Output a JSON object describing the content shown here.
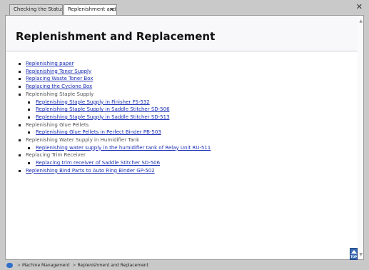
{
  "tabs": [
    {
      "label": "Checking the Status I..."
    },
    {
      "label": "Replenishment and...",
      "close": "✕"
    }
  ],
  "window": {
    "close": "✕"
  },
  "page": {
    "title": "Replenishment and Replacement"
  },
  "toc": {
    "replenishing_paper": "Replenishing paper",
    "replenishing_toner": "Replenishing Toner Supply",
    "replacing_waste_toner": "Replacing Waste Toner Box",
    "replacing_cyclone": "Replacing the Cyclone Box",
    "staple_group": "Replenishing Staple Supply",
    "staple_fs532": "Replenishing Staple Supply in Finisher FS-532",
    "staple_sd506": "Replenishing Staple Supply in Saddle Stitcher SD-506",
    "staple_sd513": "Replenishing Staple Supply in Saddle Stitcher SD-513",
    "glue_group": "Replenishing Glue Pellets",
    "glue_pb503": "Replenishing Glue Pellets in Perfect Binder PB-503",
    "water_group": "Replenishing Water Supply in Humidifier Tank",
    "water_ru511": "Replenishing water supply in the humidifier tank of Relay Unit RU-511",
    "trim_group": "Replacing Trim Receiver",
    "trim_sd506": "Replacing trim receiver of Saddle Stitcher SD-506",
    "bind_gp502": "Replenishing Bind Parts to Auto Ring Binder GP-502"
  },
  "top_button": {
    "label": "TOP"
  },
  "breadcrumb": {
    "separator": ">",
    "item1": "Machine Management",
    "item2": "Replenishment and Replacement"
  },
  "icons": {
    "home": "home-icon",
    "scroll_up": "chevron-up-icon",
    "scroll_down": "chevron-down-icon"
  },
  "colors": {
    "link": "#1a2eb5",
    "top_button": "#3b6bb3"
  }
}
